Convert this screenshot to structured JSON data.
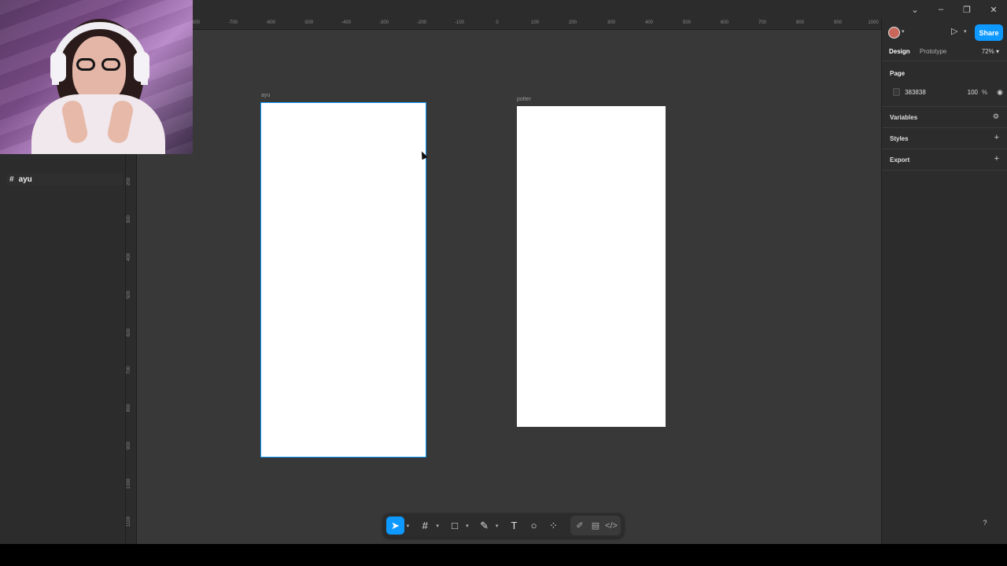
{
  "window_controls": [
    "chevron-down",
    "minimize",
    "restore",
    "close"
  ],
  "layers": [
    {
      "icon": "#",
      "label": "ayu"
    }
  ],
  "rulers": {
    "x_ticks": [
      "-800",
      "-700",
      "-600",
      "-500",
      "-400",
      "-300",
      "-200",
      "-100",
      "0",
      "100",
      "200",
      "300",
      "400",
      "500",
      "600",
      "700",
      "800",
      "900",
      "1000"
    ],
    "y_ticks": [
      "200",
      "300",
      "400",
      "500",
      "600",
      "700",
      "800",
      "900",
      "1000",
      "1100"
    ]
  },
  "canvas": {
    "frames": [
      {
        "name": "ayu",
        "selected": true
      },
      {
        "name": "potter",
        "selected": false
      }
    ]
  },
  "toolbar": {
    "tools": [
      "move-tool",
      "frame-tool",
      "shape-tool",
      "pen-tool",
      "text-tool",
      "comment-tool",
      "actions-tool"
    ],
    "mode_tools": [
      "draw-mode",
      "design-mode",
      "dev-mode"
    ]
  },
  "right_panel": {
    "share_label": "Share",
    "tabs": [
      "Design",
      "Prototype"
    ],
    "zoom": "72%",
    "page_section": {
      "title": "Page",
      "color_hex": "383838",
      "opacity": "100",
      "opacity_unit": "%"
    },
    "sections": [
      {
        "label": "Variables",
        "action": "⚙"
      },
      {
        "label": "Styles",
        "action": "+"
      },
      {
        "label": "Export",
        "action": "+"
      }
    ]
  },
  "help_label": "?",
  "colors": {
    "accent": "#0d99ff",
    "canvas_bg": "#383838",
    "panel_bg": "#2c2c2c",
    "frame_bg": "#ffffff"
  }
}
